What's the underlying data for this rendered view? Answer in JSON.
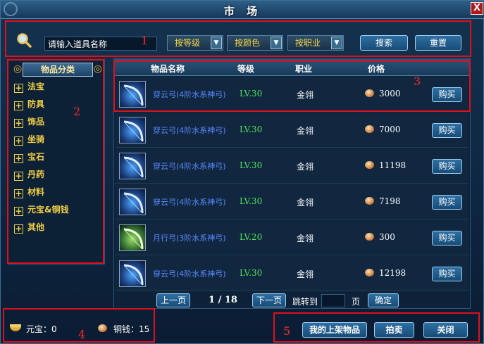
{
  "window": {
    "title": "市 场",
    "close": "X"
  },
  "search": {
    "placeholder": "请输入道具名称",
    "value": "请输入道具名称",
    "search_btn": "搜索",
    "reset_btn": "重置"
  },
  "filters": [
    {
      "label": "按等级",
      "arrow": "▼"
    },
    {
      "label": "按颜色",
      "arrow": "▼"
    },
    {
      "label": "按职业",
      "arrow": "▼"
    }
  ],
  "sidebar": {
    "title": "物品分类",
    "categories": [
      "法宝",
      "防具",
      "饰品",
      "坐骑",
      "宝石",
      "丹药",
      "材料",
      "元宝&铜钱",
      "其他"
    ]
  },
  "table": {
    "headers": {
      "name": "物品名称",
      "level": "等级",
      "job": "职业",
      "price": "价格"
    },
    "rows": [
      {
        "name": "穿云弓(4阶水系神弓)",
        "level": "LV.30",
        "job": "金翎",
        "price": "3000",
        "buy": "购买",
        "icon": "blue-bow-icon"
      },
      {
        "name": "穿云弓(4阶水系神弓)",
        "level": "LV.30",
        "job": "金翎",
        "price": "7000",
        "buy": "购买",
        "icon": "blue-bow-icon"
      },
      {
        "name": "穿云弓(4阶水系神弓)",
        "level": "LV.30",
        "job": "金翎",
        "price": "11198",
        "buy": "购买",
        "icon": "blue-bow-icon"
      },
      {
        "name": "穿云弓(4阶水系神弓)",
        "level": "LV.30",
        "job": "金翎",
        "price": "7198",
        "buy": "购买",
        "icon": "blue-bow-icon"
      },
      {
        "name": "月行弓(3阶水系神弓)",
        "level": "LV.20",
        "job": "金翎",
        "price": "300",
        "buy": "购买",
        "icon": "green-bow-icon"
      },
      {
        "name": "穿云弓(4阶水系神弓)",
        "level": "LV.30",
        "job": "金翎",
        "price": "12198",
        "buy": "购买",
        "icon": "blue-bow-icon"
      }
    ]
  },
  "pager": {
    "prev": "上一页",
    "page": "1 / 18",
    "next": "下一页",
    "jump_label": "跳转到",
    "page_unit": "页",
    "confirm": "确定"
  },
  "currency": {
    "yuanbao": "元宝：0",
    "tongqian": "铜钱：15"
  },
  "actions": {
    "my_listings": "我的上架物品",
    "auction": "拍卖",
    "close": "关闭"
  },
  "annotations": [
    "1",
    "2",
    "3",
    "4",
    "5"
  ],
  "colors": {
    "annotation_red": "#e0101b",
    "category_gold": "#f2cf45",
    "item_name_blue": "#5b87ff",
    "level_green": "#4fe25b"
  }
}
